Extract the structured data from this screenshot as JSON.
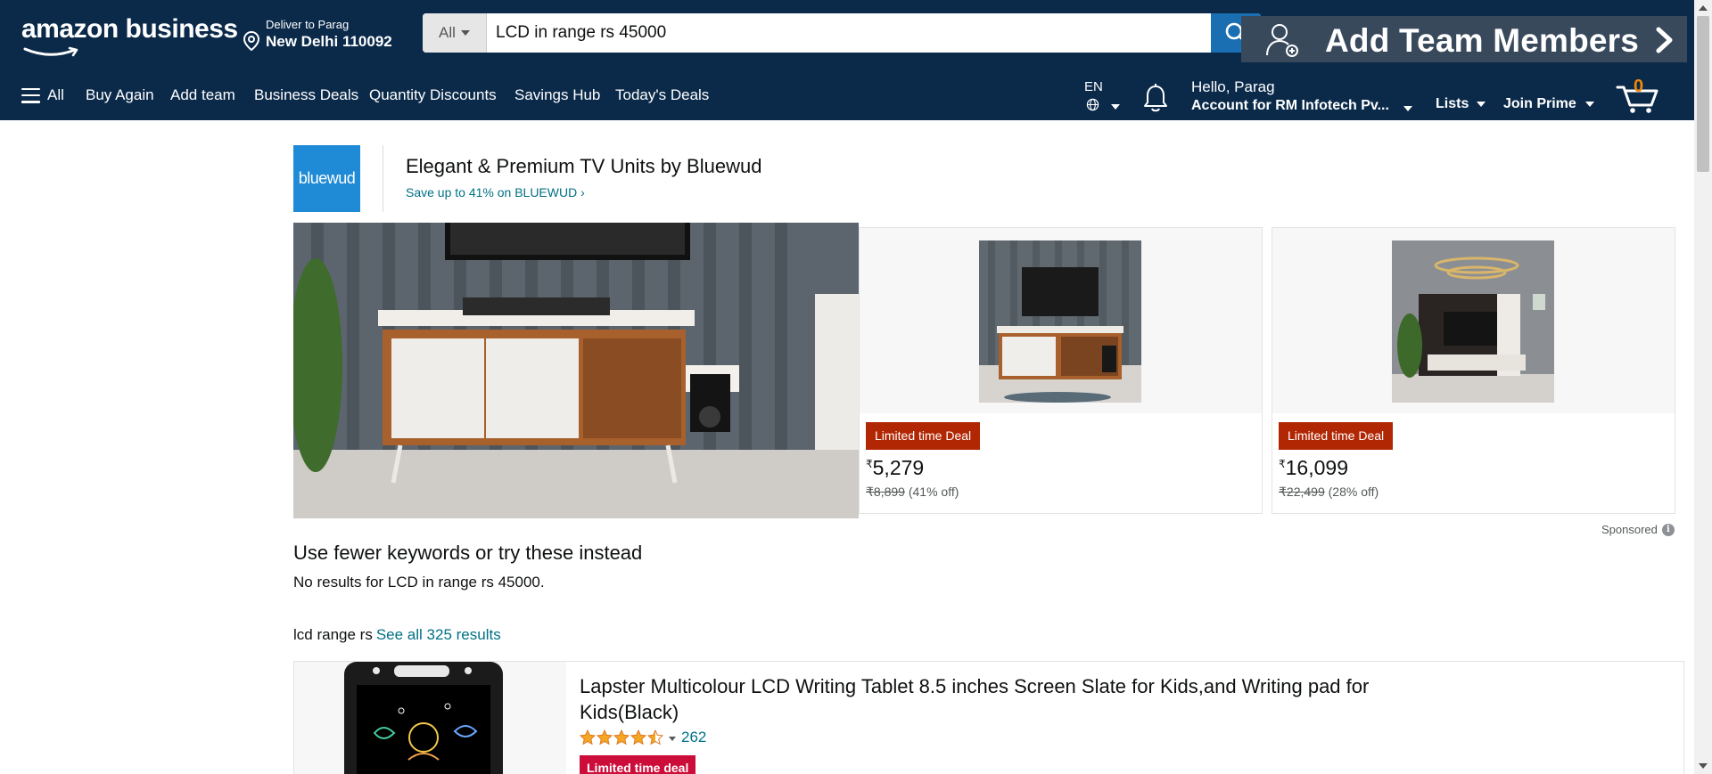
{
  "header": {
    "logo": "amazon business",
    "deliver_line1": "Deliver to Parag",
    "deliver_line2": "New Delhi 110092",
    "search": {
      "category": "All",
      "query": "LCD in range rs 45000"
    },
    "team_banner": "Add Team Members"
  },
  "nav": {
    "all_label": "All",
    "links": [
      "Buy Again",
      "Add team",
      "Business Deals",
      "Quantity Discounts",
      "Savings Hub",
      "Today's Deals"
    ],
    "lang": "EN",
    "account_line1": "Hello, Parag",
    "account_line2": "Account for RM Infotech Pv...",
    "lists": "Lists",
    "prime": "Join Prime",
    "cart_count": "0"
  },
  "sponsored_brand": {
    "logo_text": "bluewud",
    "title": "Elegant & Premium TV Units by Bluewud",
    "subtitle": "Save up to 41% on BLUEWUD ›",
    "cards": [
      {
        "deal": "Limited time Deal",
        "currency": "₹",
        "price": "5,279",
        "was": "₹8,899",
        "off": "(41% off)"
      },
      {
        "deal": "Limited time Deal",
        "currency": "₹",
        "price": "16,099",
        "was": "₹22,499",
        "off": "(28% off)"
      }
    ],
    "sponsored_label": "Sponsored"
  },
  "results": {
    "heading": "Use fewer keywords or try these instead",
    "no_results": "No results for LCD in range rs 45000.",
    "related_query": "lcd range rs",
    "see_all": "See all 325 results",
    "items": [
      {
        "title": "Lapster Multicolour LCD Writing Tablet 8.5 inches Screen Slate for Kids,and Writing pad for Kids(Black)",
        "rating": 4.5,
        "reviews": "262",
        "deal": "Limited time deal"
      }
    ]
  },
  "colors": {
    "header_bg": "#0b2a4a",
    "search_button": "#1a6fb3",
    "deal_badge": "#b12704",
    "link": "#007185",
    "star": "#f5a623"
  }
}
